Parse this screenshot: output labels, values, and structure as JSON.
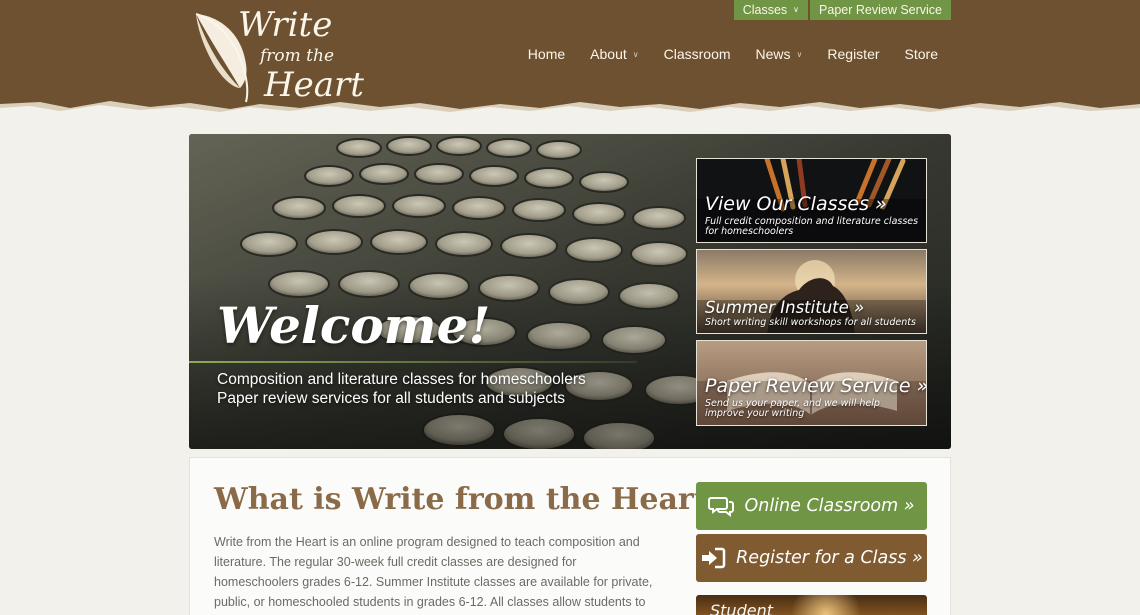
{
  "site": {
    "logo": {
      "line1": "Write",
      "line2": "from the",
      "line3": "Heart"
    }
  },
  "utility_nav": [
    {
      "label": "Classes",
      "has_dropdown": true
    },
    {
      "label": "Paper Review Service",
      "has_dropdown": false
    }
  ],
  "main_nav": [
    {
      "label": "Home",
      "has_dropdown": false
    },
    {
      "label": "About",
      "has_dropdown": true
    },
    {
      "label": "Classroom",
      "has_dropdown": false
    },
    {
      "label": "News",
      "has_dropdown": true
    },
    {
      "label": "Register",
      "has_dropdown": false
    },
    {
      "label": "Store",
      "has_dropdown": false
    }
  ],
  "hero": {
    "title": "Welcome!",
    "line1": "Composition and literature classes for homeschoolers",
    "line2": "Paper review services for all students and subjects"
  },
  "promos": [
    {
      "title": "View Our Classes »",
      "subtitle": "Full credit composition and literature classes for homeschoolers"
    },
    {
      "title": "Summer Institute »",
      "subtitle": "Short writing skill workshops for all students"
    },
    {
      "title": "Paper Review Service »",
      "subtitle": "Send us your paper, and we will help improve your writing"
    }
  ],
  "about": {
    "heading": "What is Write from the Heart?",
    "body": "Write from the Heart is an online program designed to teach composition and literature. The regular 30-week full credit classes are designed for homeschoolers grades 6-12. Summer Institute classes are available for private, public, or homeschooled students in grades 6-12. All classes allow students to interact with"
  },
  "cta": {
    "classroom_label": "Online Classroom »",
    "register_label": "Register for a Class »"
  },
  "student_card": {
    "title": "Student"
  },
  "colors": {
    "header_brown": "#6e5130",
    "accent_green": "#6f9545",
    "accent_brown": "#805b32",
    "heading_brown": "#8a6a48",
    "page_background": "#f3f1ec"
  }
}
